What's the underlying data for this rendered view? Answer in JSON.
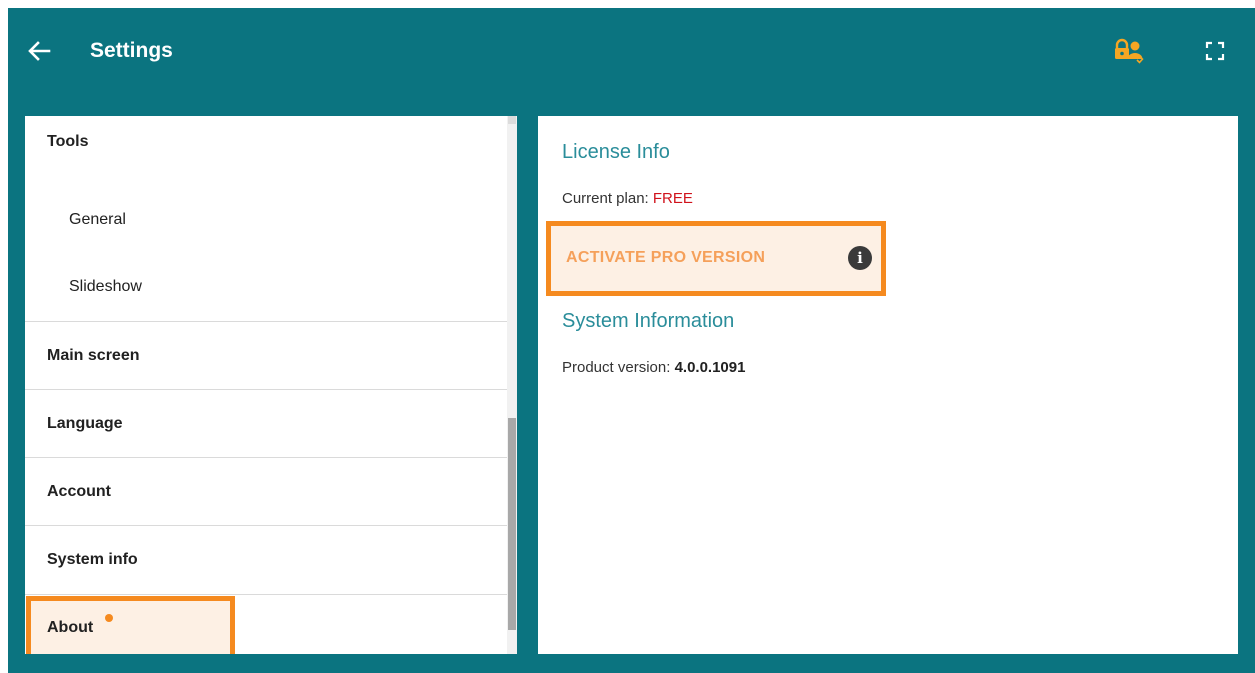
{
  "header": {
    "title": "Settings",
    "back_icon": "arrow-left-icon",
    "lock_user_icon": "lock-user-icon",
    "fullscreen_icon": "fullscreen-icon"
  },
  "sidebar": {
    "tools_heading": "Tools",
    "sub_items": [
      {
        "label": "General"
      },
      {
        "label": "Slideshow"
      }
    ],
    "items": [
      {
        "label": "Main screen"
      },
      {
        "label": "Language"
      },
      {
        "label": "Account"
      },
      {
        "label": "System info"
      }
    ],
    "about": {
      "label": "About",
      "has_notification": true
    }
  },
  "content": {
    "license": {
      "title": "License Info",
      "plan_label": "Current plan: ",
      "plan_value": "FREE",
      "activate_label": "ACTIVATE PRO VERSION"
    },
    "system": {
      "title": "System Information",
      "version_label": "Product version: ",
      "version_value": "4.0.0.1091"
    }
  },
  "colors": {
    "header_bg": "#0b7480",
    "accent": "#f58a1f",
    "section_title": "#2a8d9a",
    "plan_value": "#d0121b"
  }
}
